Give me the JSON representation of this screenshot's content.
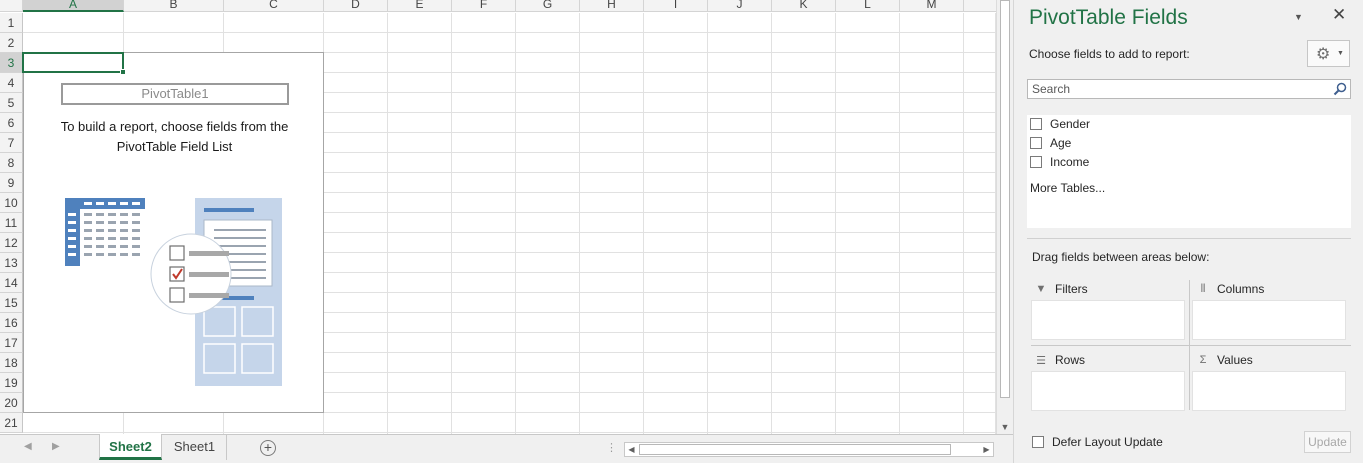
{
  "spreadsheet": {
    "columns": [
      "A",
      "B",
      "C",
      "D",
      "E",
      "F",
      "G",
      "H",
      "I",
      "J",
      "K",
      "L",
      "M"
    ],
    "rows": [
      "1",
      "2",
      "3",
      "4",
      "5",
      "6",
      "7",
      "8",
      "9",
      "10",
      "11",
      "12",
      "13",
      "14",
      "15",
      "16",
      "17",
      "18",
      "19",
      "20",
      "21"
    ],
    "active_cell": "A3"
  },
  "pivot_placeholder": {
    "name": "PivotTable1",
    "message": "To build a report, choose fields from the PivotTable Field List"
  },
  "sheet_tabs": [
    {
      "label": "Sheet2",
      "active": true
    },
    {
      "label": "Sheet1",
      "active": false
    }
  ],
  "pane": {
    "title": "PivotTable Fields",
    "choose_label": "Choose fields to add to report:",
    "search_placeholder": "Search",
    "fields": [
      {
        "label": "Gender",
        "checked": false
      },
      {
        "label": "Age",
        "checked": false
      },
      {
        "label": "Income",
        "checked": false
      }
    ],
    "more_tables": "More Tables...",
    "drag_label": "Drag fields between areas below:",
    "areas": {
      "filters": "Filters",
      "columns": "Columns",
      "rows": "Rows",
      "values": "Values"
    },
    "defer_label": "Defer Layout Update",
    "update_label": "Update"
  },
  "colors": {
    "accent": "#217346",
    "illustration_blue": "#4f81bd",
    "illustration_light": "#c5d5ea",
    "check_red": "#c0392b"
  }
}
